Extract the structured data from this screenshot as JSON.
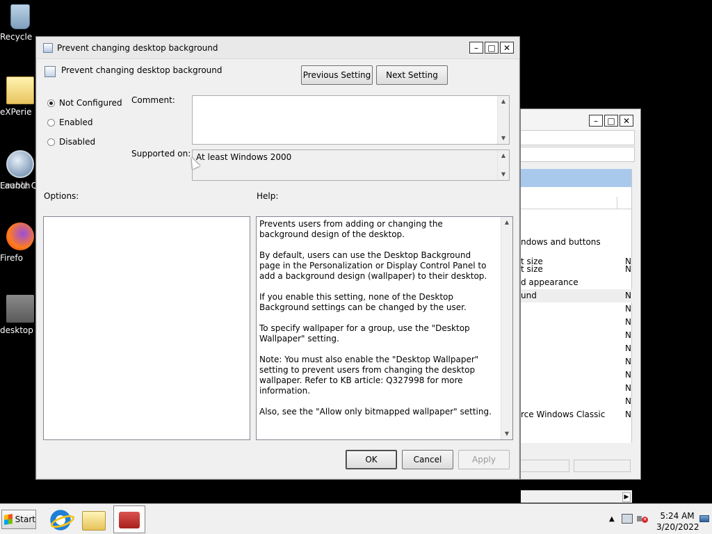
{
  "desktop": {
    "icons": [
      {
        "label": "Recycle",
        "icon": "recycle-bin-icon"
      },
      {
        "label": "eXPerie",
        "icon": "folder-icon"
      },
      {
        "label": "Enable Q",
        "label2": "Launch",
        "icon": "quick-launch-icon"
      },
      {
        "label": "Firefo",
        "icon": "firefox-icon"
      },
      {
        "label": "desktop",
        "icon": "gear-file-icon"
      }
    ]
  },
  "background_window": {
    "rows": [
      {
        "text": "ndows and buttons",
        "n": ""
      },
      {
        "text": "t size",
        "n": "N"
      },
      {
        "text": "d appearance",
        "n": ""
      },
      {
        "text": "und",
        "n": "N"
      },
      {
        "text": "",
        "n": "N"
      },
      {
        "text": "",
        "n": "N"
      },
      {
        "text": "",
        "n": "N"
      },
      {
        "text": "",
        "n": "N"
      },
      {
        "text": "",
        "n": "N"
      },
      {
        "text": "",
        "n": "N"
      },
      {
        "text": "",
        "n": "N"
      },
      {
        "text": "",
        "n": "N"
      },
      {
        "text": "rce Windows Classic",
        "n": "N"
      }
    ],
    "extra_n": "N"
  },
  "dialog": {
    "title": "Prevent changing desktop background",
    "header_title": "Prevent changing desktop background",
    "previous_label": "Previous Setting",
    "next_label": "Next Setting",
    "radios": {
      "not_configured": "Not Configured",
      "enabled": "Enabled",
      "disabled": "Disabled",
      "selected": "not_configured"
    },
    "comment_label": "Comment:",
    "comment_value": "",
    "supported_label": "Supported on:",
    "supported_value": "At least Windows 2000",
    "options_label": "Options:",
    "help_label": "Help:",
    "help_paragraphs": [
      "Prevents users from adding or changing the background design of the desktop.",
      "By default, users can use the Desktop Background page in the Personalization or Display Control Panel to add a background design (wallpaper) to their desktop.",
      "If you enable this setting, none of the Desktop Background settings can be changed by the user.",
      "To specify wallpaper for a group, use the \"Desktop Wallpaper\" setting.",
      "Note: You must also enable the \"Desktop Wallpaper\" setting to prevent users from changing the desktop wallpaper. Refer to KB article: Q327998 for more information.",
      "Also, see the \"Allow only bitmapped wallpaper\" setting."
    ],
    "ok_label": "OK",
    "cancel_label": "Cancel",
    "apply_label": "Apply"
  },
  "taskbar": {
    "start_label": "Start",
    "time": "5:24 AM",
    "date": "3/20/2022"
  },
  "colors": {
    "desktop": "#000000",
    "window_bg": "#f0f0f0",
    "selection_blue": "#a8c9ec"
  }
}
